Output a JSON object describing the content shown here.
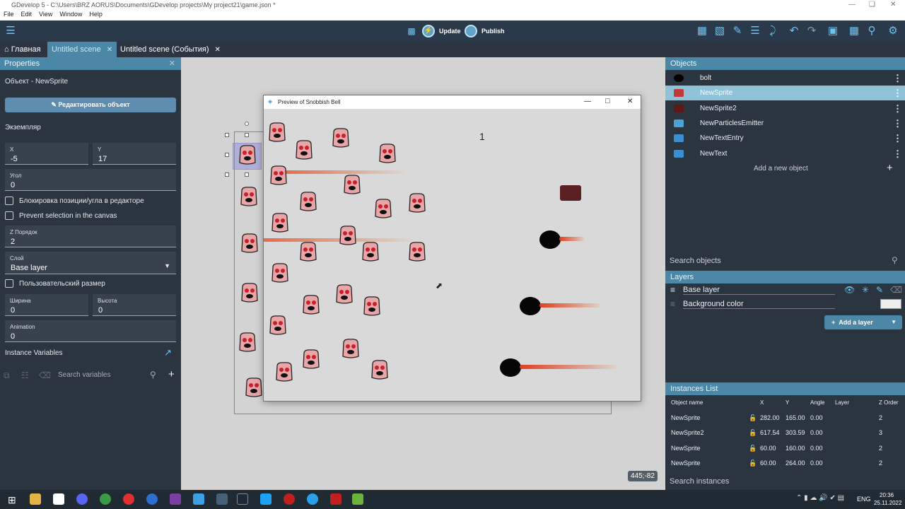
{
  "window": {
    "title": "GDevelop 5 - C:\\Users\\BRZ AORUS\\Documents\\GDevelop projects\\My project21\\game.json *"
  },
  "menu": [
    "File",
    "Edit",
    "View",
    "Window",
    "Help"
  ],
  "toolbar": {
    "update_label": "Update",
    "publish_label": "Publish"
  },
  "tabs": [
    "Главная",
    "Untitled scene",
    "Untitled scene (События)"
  ],
  "properties": {
    "header": "Properties",
    "object_line": "Объект  - NewSprite",
    "edit_button": "Редактировать объект",
    "instance_label": "Экземпляр",
    "x_label": "X",
    "x_value": "-5",
    "y_label": "Y",
    "y_value": "17",
    "angle_label": "Угол",
    "angle_value": "0",
    "lock_label": "Блокировка позиции/угла в редакторе",
    "prevent_label": "Prevent selection in the canvas",
    "z_label": "Z Порядок",
    "z_value": "2",
    "layer_label": "Слой",
    "layer_value": "Base layer",
    "custom_size_label": "Пользовательский размер",
    "width_label": "Ширина",
    "width_value": "0",
    "height_label": "Высота",
    "height_value": "0",
    "animation_label": "Animation",
    "animation_value": "0",
    "instance_vars_label": "Instance Variables",
    "search_vars_placeholder": "Search variables"
  },
  "preview": {
    "title": "Preview of Snobbish Bell",
    "score": "1"
  },
  "objects": {
    "header": "Objects",
    "items": [
      {
        "name": "bolt",
        "color": "#000000"
      },
      {
        "name": "NewSprite",
        "color": "#c0393b"
      },
      {
        "name": "NewSprite2",
        "color": "#5a1a1a"
      },
      {
        "name": "NewParticlesEmitter",
        "color": "#4aa3d6"
      },
      {
        "name": "NewTextEntry",
        "color": "#3b8fd1"
      },
      {
        "name": "NewText",
        "color": "#3b8fd1"
      }
    ],
    "add_label": "Add a new object",
    "search_placeholder": "Search objects"
  },
  "layers": {
    "header": "Layers",
    "items": [
      "Base layer",
      "Background color"
    ],
    "add_label": "Add a layer"
  },
  "instances": {
    "header": "Instances List",
    "columns": [
      "Object name",
      "X",
      "Y",
      "Angle",
      "Layer",
      "Z Order"
    ],
    "rows": [
      [
        "NewSprite",
        "282.00",
        "165.00",
        "0.00",
        "",
        "2"
      ],
      [
        "NewSprite2",
        "617.54",
        "303.59",
        "0.00",
        "",
        "3"
      ],
      [
        "NewSprite",
        "60.00",
        "160.00",
        "0.00",
        "",
        "2"
      ],
      [
        "NewSprite",
        "60.00",
        "264.00",
        "0.00",
        "",
        "2"
      ]
    ],
    "search_placeholder": "Search instances"
  },
  "canvas": {
    "coords": "445;-82"
  },
  "taskbar": {
    "lang": "ENG",
    "time": "20:36",
    "date": "25.11.2022"
  }
}
